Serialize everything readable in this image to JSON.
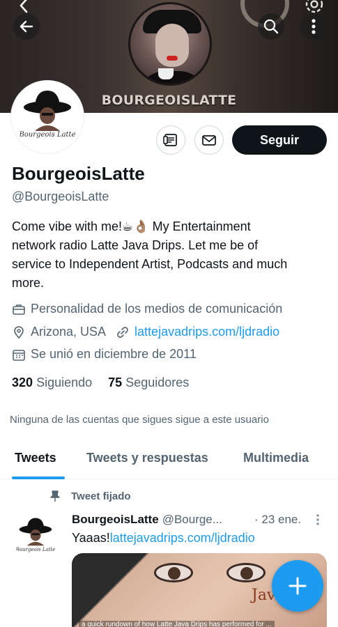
{
  "banner": {
    "title": "BOURGEOISLATTE"
  },
  "header": {
    "back_icon": "arrow-left-icon",
    "search_icon": "search-icon",
    "more_icon": "more-vertical-icon"
  },
  "profile": {
    "avatar_signature": "Bourgeois Latte",
    "name": "BourgeoisLatte",
    "handle": "@BourgeoisLatte",
    "bio_line1": "Come vibe with me!☕👌🏽 My Entertainment",
    "bio_line2": "network radio Latte Java Drips. Let me be of",
    "bio_line3": "service to Independent Artist, Podcasts and much",
    "bio_line4": "more.",
    "category": "Personalidad de los medios de comunicación",
    "location": "Arizona, USA",
    "website": "lattejavadrips.com/ljdradio",
    "joined": "Se unió en diciembre de 2011",
    "following_count": "320",
    "following_label": "Siguiendo",
    "followers_count": "75",
    "followers_label": "Seguidores",
    "notice": "Ninguna de las cuentas que sigues sigue a este usuario"
  },
  "actions": {
    "follow_label": "Seguir"
  },
  "tabs": [
    "Tweets",
    "Tweets y respuestas",
    "Multimedia"
  ],
  "tweet": {
    "pinned_label": "Tweet fijado",
    "author_name": "BourgeoisLatte",
    "author_handle": "@Bourge...",
    "date": "· 23 ene.",
    "text_prefix": "Yaaas!",
    "text_link": "lattejavadrips.com/ljdradio",
    "media_brand": "Jav",
    "media_caption": "a quick rundown of how Latte Java Drips has performed for ..."
  },
  "colors": {
    "accent": "#1d9bf0",
    "text_primary": "#0f1419",
    "text_secondary": "#536471",
    "follow_button": "#0f1419"
  }
}
